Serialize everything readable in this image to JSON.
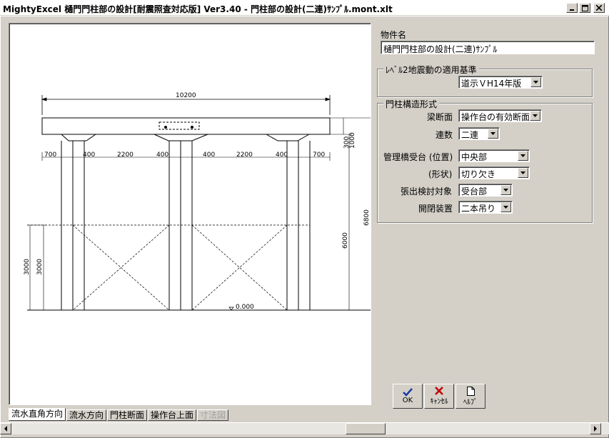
{
  "window": {
    "title": "MightyExcel 樋門門柱部の設計[耐震照査対応版] Ver3.40 - 門柱部の設計(二連)ｻﾝﾌﾟﾙ.mont.xlt"
  },
  "drawing": {
    "dim_total": "10200",
    "dim_segments": [
      "700",
      "400",
      "2200",
      "400",
      "400",
      "2200",
      "400",
      "700"
    ],
    "dim_beam_a": "300",
    "dim_beam_b": "1000",
    "dim_height_6000": "6000",
    "dim_height_6800": "6800",
    "dim_left_3000_a": "3000",
    "dim_left_3000_b": "3000",
    "elevation": "0.000"
  },
  "tabs": [
    "流水直角方向",
    "流水方向",
    "門柱断面",
    "操作台上面",
    "寸法図"
  ],
  "form": {
    "project_name_label": "物件名",
    "project_name_value": "樋門門柱部の設計(二連)ｻﾝﾌﾟﾙ",
    "seismic_group_title": "ﾚﾍﾞﾙ2地震動の適用基準",
    "seismic_value": "道示ＶH14年版",
    "structure_group_title": "門柱構造形式",
    "fields": [
      {
        "label": "梁断面",
        "value": "操作台の有効断面"
      },
      {
        "label": "連数",
        "value": "二連"
      },
      {
        "label": "管理橋受台 (位置)",
        "value": "中央部"
      },
      {
        "label": "(形状)",
        "value": "切り欠き"
      },
      {
        "label": "張出検討対象",
        "value": "受台部"
      },
      {
        "label": "開閉装置",
        "value": "二本吊り"
      }
    ]
  },
  "buttons": {
    "ok": "OK",
    "cancel": "ｷｬﾝｾﾙ",
    "help": "ﾍﾙﾌﾟ"
  }
}
